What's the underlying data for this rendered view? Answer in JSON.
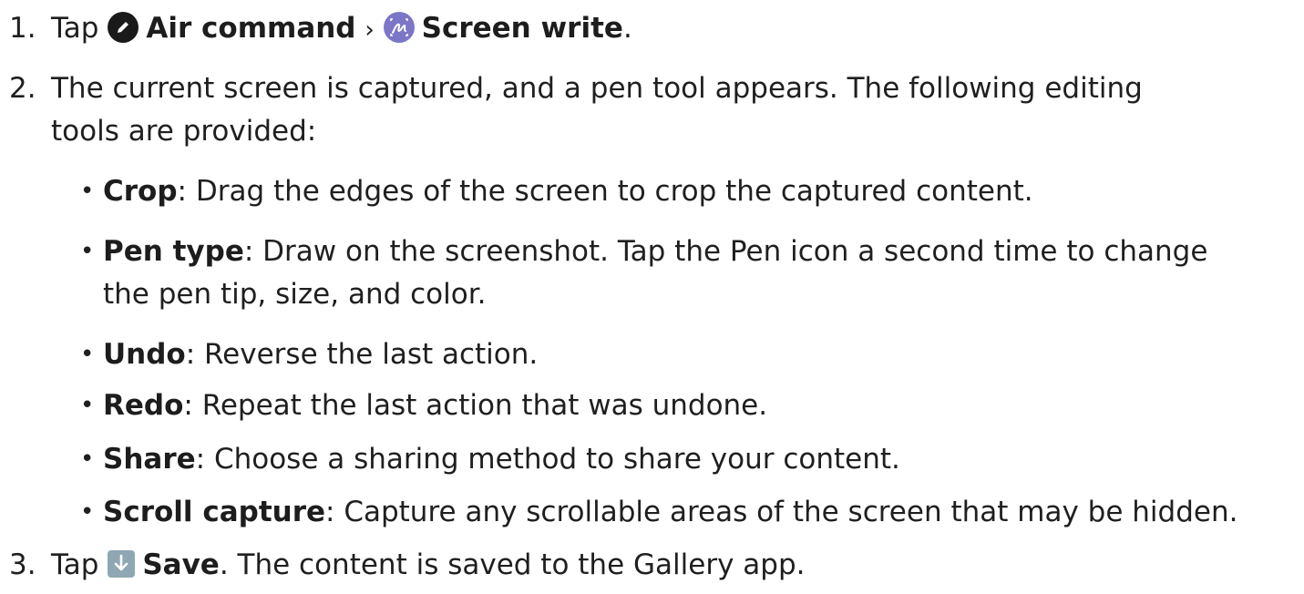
{
  "steps": [
    {
      "number": "1.",
      "tap": "Tap",
      "air_command_icon": "pen-circle-icon",
      "air_command": "Air command",
      "separator": "›",
      "screen_write_icon": "screen-write-icon",
      "screen_write": "Screen write",
      "end": "."
    },
    {
      "number": "2.",
      "line1": "The current screen is captured, and a pen tool appears. The following editing",
      "line2": "tools are provided:",
      "bullets": [
        {
          "term": "Crop",
          "text": ": Drag the edges of the screen to crop the captured content."
        },
        {
          "term": "Pen type",
          "text": ": Draw on the screenshot. Tap the Pen icon a second time to change",
          "text2": "the pen tip, size, and color."
        },
        {
          "term": "Undo",
          "text": ": Reverse the last action."
        },
        {
          "term": "Redo",
          "text": ": Repeat the last action that was undone."
        },
        {
          "term": "Share",
          "text": ": Choose a sharing method to share your content."
        },
        {
          "term": "Scroll capture",
          "text": ": Capture any scrollable areas of the screen that may be hidden."
        }
      ]
    },
    {
      "number": "3.",
      "tap": "Tap",
      "save_icon": "download-arrow-icon",
      "save": "Save",
      "rest": ". The content is saved to the Gallery app."
    }
  ],
  "colors": {
    "air_command_icon": "#1a1a1a",
    "screen_write_icon": "#7b76c8",
    "save_icon": "#8fa7b3"
  }
}
